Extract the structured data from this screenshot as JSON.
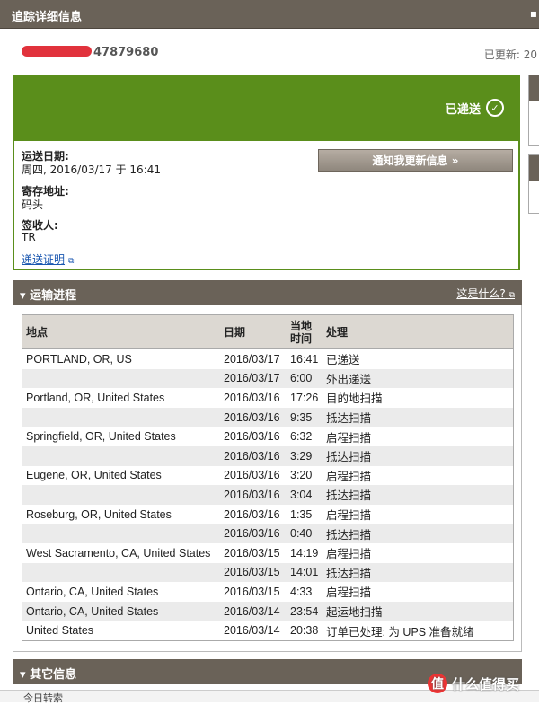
{
  "header": {
    "title": "追踪详细信息",
    "collapse_icon": "▪"
  },
  "tracking": {
    "number_suffix": "47879680",
    "updated_label": "已更新: 20"
  },
  "status": {
    "text": "已递送",
    "icon": "check-circle-icon"
  },
  "delivery": {
    "date_label": "运送日期:",
    "date_value": "周四, 2016/03/17 于 16:41",
    "left_at_label": "寄存地址:",
    "left_at_value": "码头",
    "signed_by_label": "签收人:",
    "signed_by_value": "TR",
    "proof_link": "递送证明",
    "notify_button": "通知我更新信息 »"
  },
  "progress": {
    "title": "运输进程",
    "what_link": "这是什么?",
    "columns": {
      "location": "地点",
      "date": "日期",
      "local_time": "当地时间",
      "activity": "处理"
    },
    "rows": [
      {
        "location": "PORTLAND, OR, US",
        "date": "2016/03/17",
        "time": "16:41",
        "activity": "已递送"
      },
      {
        "location": "",
        "date": "2016/03/17",
        "time": "6:00",
        "activity": "外出递送"
      },
      {
        "location": "Portland, OR, United States",
        "date": "2016/03/16",
        "time": "17:26",
        "activity": "目的地扫描"
      },
      {
        "location": "",
        "date": "2016/03/16",
        "time": "9:35",
        "activity": "抵达扫描"
      },
      {
        "location": "Springfield, OR, United States",
        "date": "2016/03/16",
        "time": "6:32",
        "activity": "启程扫描"
      },
      {
        "location": "",
        "date": "2016/03/16",
        "time": "3:29",
        "activity": "抵达扫描"
      },
      {
        "location": "Eugene, OR, United States",
        "date": "2016/03/16",
        "time": "3:20",
        "activity": "启程扫描"
      },
      {
        "location": "",
        "date": "2016/03/16",
        "time": "3:04",
        "activity": "抵达扫描"
      },
      {
        "location": "Roseburg, OR, United States",
        "date": "2016/03/16",
        "time": "1:35",
        "activity": "启程扫描"
      },
      {
        "location": "",
        "date": "2016/03/16",
        "time": "0:40",
        "activity": "抵达扫描"
      },
      {
        "location": "West Sacramento, CA, United States",
        "date": "2016/03/15",
        "time": "14:19",
        "activity": "启程扫描"
      },
      {
        "location": "",
        "date": "2016/03/15",
        "time": "14:01",
        "activity": "抵达扫描"
      },
      {
        "location": "Ontario, CA, United States",
        "date": "2016/03/15",
        "time": "4:33",
        "activity": "启程扫描"
      },
      {
        "location": "Ontario, CA, United States",
        "date": "2016/03/14",
        "time": "23:54",
        "activity": "起运地扫描"
      },
      {
        "location": "United States",
        "date": "2016/03/14",
        "time": "20:38",
        "activity": "订单已处理: 为 UPS 准备就绪"
      }
    ]
  },
  "other_info": {
    "title": "其它信息"
  },
  "bottom": {
    "text": "今日转索"
  },
  "watermark": {
    "logo": "值",
    "text": "什么值得买"
  }
}
